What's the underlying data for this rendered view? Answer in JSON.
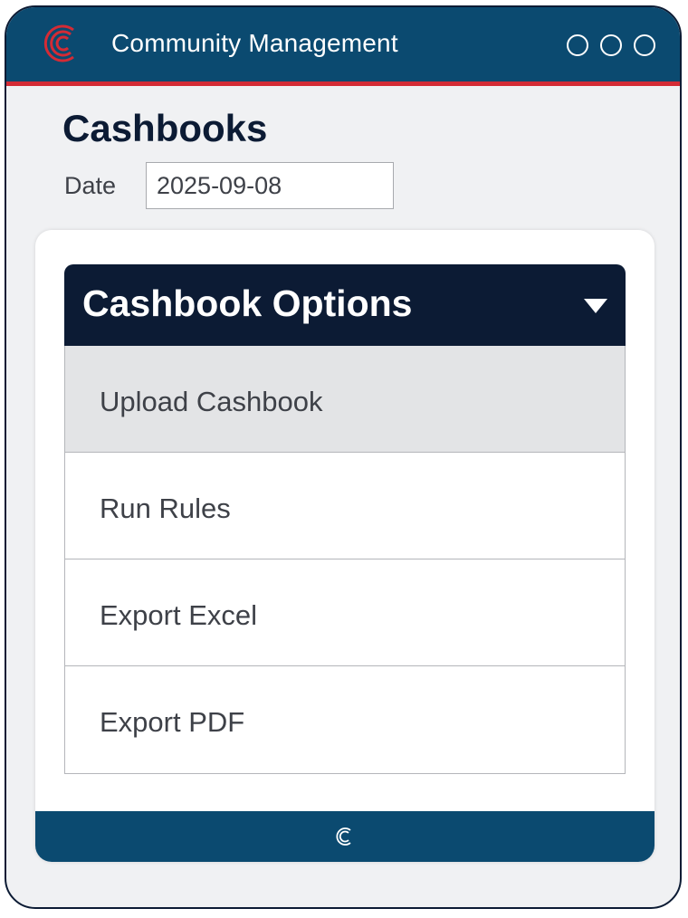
{
  "header": {
    "app_title": "Community Management",
    "logo_icon": "community-c-logo-icon",
    "window_controls": [
      "circle-control-icon",
      "circle-control-icon",
      "circle-control-icon"
    ]
  },
  "page": {
    "title": "Cashbooks",
    "date_label": "Date",
    "date_value": "2025-09-08"
  },
  "options": {
    "title": "Cashbook Options",
    "caret_icon": "caret-down-icon",
    "items": [
      {
        "label": "Upload Cashbook",
        "active": true
      },
      {
        "label": "Run Rules",
        "active": false
      },
      {
        "label": "Export Excel",
        "active": false
      },
      {
        "label": "Export PDF",
        "active": false
      }
    ]
  },
  "footer": {
    "logo_icon": "community-c-logo-icon"
  },
  "colors": {
    "header_blue": "#0b4a70",
    "accent_red": "#d42b35",
    "navy": "#0c1b34",
    "text_gray": "#3e4148",
    "active_row": "#e3e4e6",
    "background": "#f0f1f3"
  }
}
